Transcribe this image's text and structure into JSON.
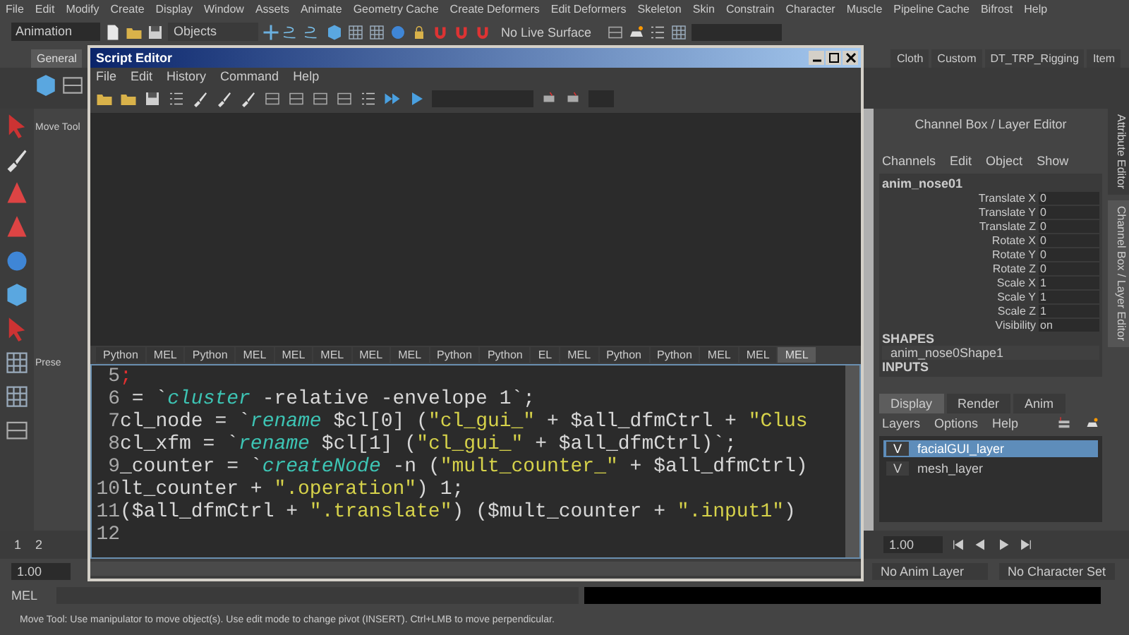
{
  "menu_bar": [
    "File",
    "Edit",
    "Modify",
    "Create",
    "Display",
    "Window",
    "Assets",
    "Animate",
    "Geometry Cache",
    "Create Deformers",
    "Edit Deformers",
    "Skeleton",
    "Skin",
    "Constrain",
    "Character",
    "Muscle",
    "Pipeline Cache",
    "Bifrost",
    "Help"
  ],
  "status_line": {
    "mode": "Animation",
    "selection_field": "Objects",
    "live_surface": "No Live Surface"
  },
  "shelf_tabs": [
    {
      "label": "General",
      "selected": true
    },
    {
      "label": "Cloth",
      "selected": false
    },
    {
      "label": "Custom",
      "selected": false
    },
    {
      "label": "DT_TRP_Rigging",
      "selected": false
    },
    {
      "label": "Item",
      "selected": false
    }
  ],
  "tool_settings": {
    "title": "Move Tool",
    "section": "Prese"
  },
  "script_editor": {
    "title": "Script Editor",
    "menu": [
      "File",
      "Edit",
      "History",
      "Command",
      "Help"
    ],
    "tabs": [
      {
        "label": "Python",
        "selected": false
      },
      {
        "label": "MEL",
        "selected": false
      },
      {
        "label": "Python",
        "selected": false
      },
      {
        "label": "MEL",
        "selected": false
      },
      {
        "label": "MEL",
        "selected": false
      },
      {
        "label": "MEL",
        "selected": false
      },
      {
        "label": "MEL",
        "selected": false
      },
      {
        "label": "MEL",
        "selected": false
      },
      {
        "label": "Python",
        "selected": false
      },
      {
        "label": "Python",
        "selected": false
      },
      {
        "label": "EL",
        "selected": false
      },
      {
        "label": "MEL",
        "selected": false
      },
      {
        "label": "Python",
        "selected": false
      },
      {
        "label": "Python",
        "selected": false
      },
      {
        "label": "MEL",
        "selected": false
      },
      {
        "label": "MEL",
        "selected": false
      },
      {
        "label": "MEL",
        "selected": true
      }
    ],
    "code_lines": [
      {
        "number": "5",
        "segments": [
          {
            "kind": "error",
            "text": ";"
          }
        ]
      },
      {
        "number": "6",
        "segments": [
          {
            "kind": "plain",
            "text": " = `"
          },
          {
            "kind": "keyword",
            "text": "cluster"
          },
          {
            "kind": "plain",
            "text": " -relative -envelope 1`;"
          }
        ]
      },
      {
        "number": "7",
        "segments": [
          {
            "kind": "plain",
            "text": "cl_node = `"
          },
          {
            "kind": "keyword",
            "text": "rename"
          },
          {
            "kind": "plain",
            "text": " $cl[0] ("
          },
          {
            "kind": "string",
            "text": "\"cl_gui_\""
          },
          {
            "kind": "plain",
            "text": " + $all_dfmCtrl + "
          },
          {
            "kind": "string",
            "text": "\"Clus"
          }
        ]
      },
      {
        "number": "8",
        "segments": [
          {
            "kind": "plain",
            "text": "cl_xfm = `"
          },
          {
            "kind": "keyword",
            "text": "rename"
          },
          {
            "kind": "plain",
            "text": " $cl[1] ("
          },
          {
            "kind": "string",
            "text": "\"cl_gui_\""
          },
          {
            "kind": "plain",
            "text": " + $all_dfmCtrl)`;"
          }
        ]
      },
      {
        "number": "9",
        "segments": [
          {
            "kind": "plain",
            "text": "_counter = `"
          },
          {
            "kind": "keyword",
            "text": "createNode"
          },
          {
            "kind": "plain",
            "text": " -n ("
          },
          {
            "kind": "string",
            "text": "\"mult_counter_\""
          },
          {
            "kind": "plain",
            "text": " + $all_dfmCtrl)"
          }
        ]
      },
      {
        "number": "10",
        "segments": [
          {
            "kind": "plain",
            "text": "lt_counter + "
          },
          {
            "kind": "string",
            "text": "\".operation\""
          },
          {
            "kind": "plain",
            "text": ") 1;"
          }
        ]
      },
      {
        "number": "11",
        "segments": [
          {
            "kind": "plain",
            "text": "($all_dfmCtrl + "
          },
          {
            "kind": "string",
            "text": "\".translate\""
          },
          {
            "kind": "plain",
            "text": ") ($mult_counter + "
          },
          {
            "kind": "string",
            "text": "\".input1\""
          },
          {
            "kind": "plain",
            "text": ")"
          }
        ]
      },
      {
        "number": "12"
      }
    ]
  },
  "channel_box": {
    "title": "Channel Box / Layer Editor",
    "menu": [
      "Channels",
      "Edit",
      "Object",
      "Show"
    ],
    "node": "anim_nose01",
    "channels": [
      {
        "name": "Translate X",
        "value": "0"
      },
      {
        "name": "Translate Y",
        "value": "0"
      },
      {
        "name": "Translate Z",
        "value": "0"
      },
      {
        "name": "Rotate X",
        "value": "0"
      },
      {
        "name": "Rotate Y",
        "value": "0"
      },
      {
        "name": "Rotate Z",
        "value": "0"
      },
      {
        "name": "Scale X",
        "value": "1"
      },
      {
        "name": "Scale Y",
        "value": "1"
      },
      {
        "name": "Scale Z",
        "value": "1"
      },
      {
        "name": "Visibility",
        "value": "on"
      }
    ],
    "shapes_heading": "SHAPES",
    "shape": "anim_nose0Shape1",
    "inputs_heading": "INPUTS"
  },
  "layer_editor": {
    "tabs": [
      {
        "label": "Display",
        "selected": true
      },
      {
        "label": "Render",
        "selected": false
      },
      {
        "label": "Anim",
        "selected": false
      }
    ],
    "menu": [
      "Layers",
      "Options",
      "Help"
    ],
    "layers": [
      {
        "visibility": "V",
        "name": "facialGUI_layer",
        "selected": true
      },
      {
        "visibility": "V",
        "name": "mesh_layer",
        "selected": false
      }
    ]
  },
  "side_tabs": [
    {
      "label": "Attribute Editor",
      "selected": false
    },
    {
      "label": "Channel Box / Layer Editor",
      "selected": true
    }
  ],
  "time_slider": {
    "frames": [
      "1",
      "2"
    ],
    "current_time": "1.00"
  },
  "range_slider": {
    "start": "1.00",
    "anim_layer": "No Anim Layer",
    "character_set": "No Character Set"
  },
  "command_line": {
    "label": "MEL"
  },
  "help_line": "Move Tool: Use manipulator to move object(s). Use edit mode to change pivot (INSERT).  Ctrl+LMB to move perpendicular."
}
